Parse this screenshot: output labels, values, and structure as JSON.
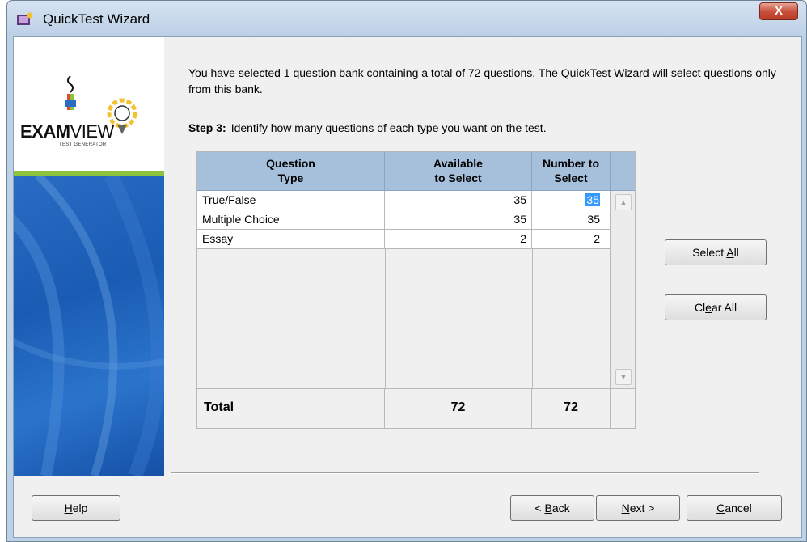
{
  "window": {
    "title": "QuickTest Wizard",
    "close_glyph": "X"
  },
  "sidebar": {
    "logo_main": "EXAM",
    "logo_light": "VIEW",
    "logo_sub": "TEST GENERATOR"
  },
  "content": {
    "intro": "You have selected 1 question bank containing a total of 72 questions.  The QuickTest Wizard will select questions only from this bank.",
    "step_label": "Step 3:",
    "step_text": "Identify how many questions of each type you want on the test."
  },
  "table": {
    "headers": {
      "type_1": "Question",
      "type_2": "Type",
      "avail_1": "Available",
      "avail_2": "to Select",
      "num_1": "Number to",
      "num_2": "Select"
    },
    "rows": [
      {
        "type": "True/False",
        "available": "35",
        "number": "35"
      },
      {
        "type": "Multiple Choice",
        "available": "35",
        "number": "35"
      },
      {
        "type": "Essay",
        "available": "2",
        "number": "2"
      }
    ],
    "total": {
      "label": "Total",
      "available": "72",
      "number": "72"
    }
  },
  "side_buttons": {
    "select_all_pre": "Select ",
    "select_all_key": "A",
    "select_all_post": "ll",
    "clear_all_pre": "Cl",
    "clear_all_key": "e",
    "clear_all_post": "ar All"
  },
  "footer": {
    "help_key": "H",
    "help_post": "elp",
    "back_pre": "< ",
    "back_key": "B",
    "back_post": "ack",
    "next_key": "N",
    "next_post": "ext >",
    "cancel_key": "C",
    "cancel_post": "ancel"
  },
  "colors": {
    "header_bg": "#a6c0dc",
    "selection": "#3399ff",
    "sidebar_blue": "#1a5cb3",
    "sidebar_green": "#8bc33e"
  }
}
